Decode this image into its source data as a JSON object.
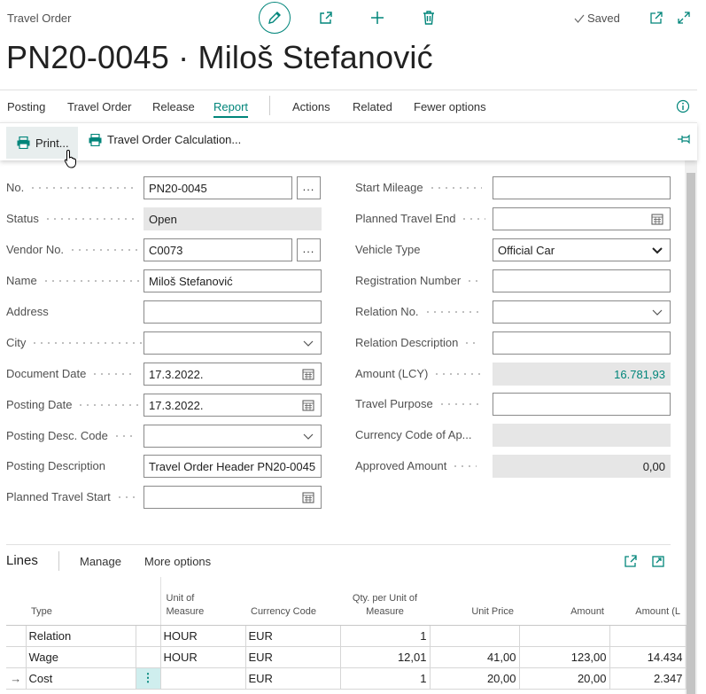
{
  "header": {
    "page_type": "Travel Order",
    "saved_label": "Saved",
    "title": "PN20-0045 · Miloš Stefanović"
  },
  "menu": {
    "items": [
      "Posting",
      "Travel Order",
      "Release",
      "Report",
      "Actions",
      "Related",
      "Fewer options"
    ],
    "active": "Report"
  },
  "submenu": {
    "print_label": "Print...",
    "calc_label": "Travel Order Calculation..."
  },
  "form": {
    "left": [
      {
        "label": "No.",
        "value": "PN20-0045",
        "kind": "lookup"
      },
      {
        "label": "Status",
        "value": "Open",
        "kind": "readonly"
      },
      {
        "label": "Vendor No.",
        "value": "C0073",
        "kind": "lookup"
      },
      {
        "label": "Name",
        "value": "Miloš Stefanović",
        "kind": "text"
      },
      {
        "label": "Address",
        "value": "",
        "kind": "text"
      },
      {
        "label": "City",
        "value": "",
        "kind": "dropdown"
      },
      {
        "label": "Document Date",
        "value": "17.3.2022.",
        "kind": "date"
      },
      {
        "label": "Posting Date",
        "value": "17.3.2022.",
        "kind": "date"
      },
      {
        "label": "Posting Desc. Code",
        "value": "",
        "kind": "dropdown"
      },
      {
        "label": "Posting Description",
        "value": "Travel Order Header PN20-0045",
        "kind": "text"
      },
      {
        "label": "Planned Travel Start",
        "value": "",
        "kind": "date"
      }
    ],
    "right": [
      {
        "label": "Start Mileage",
        "value": "",
        "kind": "text"
      },
      {
        "label": "Planned Travel End",
        "value": "",
        "kind": "date"
      },
      {
        "label": "Vehicle Type",
        "value": "Official Car",
        "kind": "select"
      },
      {
        "label": "Registration Number",
        "value": "",
        "kind": "text"
      },
      {
        "label": "Relation No.",
        "value": "",
        "kind": "dropdown"
      },
      {
        "label": "Relation Description",
        "value": "",
        "kind": "text"
      },
      {
        "label": "Amount (LCY)",
        "value": "16.781,93",
        "kind": "readonly-num-link"
      },
      {
        "label": "Travel Purpose",
        "value": "",
        "kind": "text"
      },
      {
        "label": "Currency Code of Ap...",
        "value": "",
        "kind": "readonly"
      },
      {
        "label": "Approved Amount",
        "value": "0,00",
        "kind": "readonly-num"
      }
    ]
  },
  "lines": {
    "title": "Lines",
    "manage_label": "Manage",
    "more_label": "More options",
    "columns": [
      "Type",
      "Unit of\nMeasure",
      "Currency Code",
      "Qty. per Unit of\nMeasure",
      "Unit Price",
      "Amount",
      "Amount (L"
    ],
    "rows": [
      {
        "indicator": "",
        "type": "Relation",
        "uom": "HOUR",
        "currency": "EUR",
        "qty": "1",
        "unit_price": "",
        "amount": "",
        "amount_lcy": ""
      },
      {
        "indicator": "",
        "type": "Wage",
        "uom": "HOUR",
        "currency": "EUR",
        "qty": "12,01",
        "unit_price": "41,00",
        "amount": "123,00",
        "amount_lcy": "14.434"
      },
      {
        "indicator": "→",
        "type": "Cost",
        "uom": "",
        "currency": "EUR",
        "qty": "1",
        "unit_price": "20,00",
        "amount": "20,00",
        "amount_lcy": "2.347"
      }
    ]
  },
  "colors": {
    "accent": "#00857a",
    "readonly_bg": "#e6e6e6"
  }
}
